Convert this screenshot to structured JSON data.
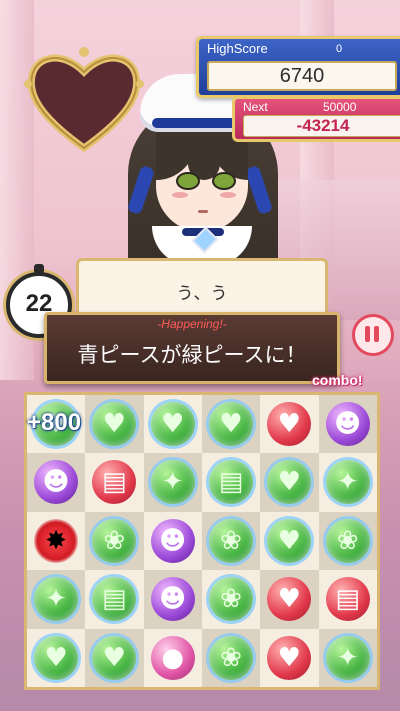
{
  "score": {
    "highscore_label": "HighScore",
    "highscore_best": "0",
    "current_score": "6740",
    "next_label": "Next",
    "next_target": "50000",
    "next_remaining": "-43214"
  },
  "timer": {
    "value": "22"
  },
  "dialog": {
    "text": "う、う"
  },
  "happening": {
    "title": "-Happening!-",
    "message": "青ピースが緑ピースに！"
  },
  "combo_label": "combo!",
  "board_bonus": "+800",
  "colors": {
    "accent_gold": "#d9b770",
    "highscore_blue": "#2f52b5",
    "next_pink": "#d13c66",
    "combo_text": "#d0306b"
  },
  "board": {
    "rows": [
      [
        "green-heart",
        "green-heart",
        "green-heart-broken",
        "green-heart-broken",
        "red-heart",
        "purple-devil"
      ],
      [
        "purple-devil",
        "red-book",
        "green-star",
        "green-book",
        "green-heart",
        "green-star-broken"
      ],
      [
        "red-burst",
        "green-bow",
        "purple-devil",
        "green-bow",
        "green-heart",
        "green-bow"
      ],
      [
        "green-star",
        "green-book",
        "purple-devil",
        "green-bow",
        "red-heart",
        "red-book"
      ],
      [
        "green-heart",
        "green-heart",
        "pink-bomb",
        "green-bow",
        "red-heart",
        "green-star"
      ]
    ]
  }
}
